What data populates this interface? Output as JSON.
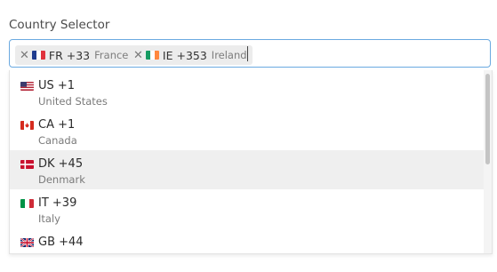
{
  "selector": {
    "label": "Country Selector",
    "selected": [
      {
        "flag": "fr",
        "code": "FR +33",
        "name": "France"
      },
      {
        "flag": "ie",
        "code": "IE +353",
        "name": "Ireland"
      }
    ],
    "remove_glyph": "✕"
  },
  "dropdown": {
    "options": [
      {
        "flag": "us",
        "code": "US +1",
        "name": "United States",
        "highlighted": false
      },
      {
        "flag": "ca",
        "code": "CA +1",
        "name": "Canada",
        "highlighted": false
      },
      {
        "flag": "dk",
        "code": "DK +45",
        "name": "Denmark",
        "highlighted": true
      },
      {
        "flag": "it",
        "code": "IT +39",
        "name": "Italy",
        "highlighted": false
      },
      {
        "flag": "gb",
        "code": "GB +44",
        "name": "",
        "highlighted": false
      }
    ]
  },
  "colors": {
    "focus_border": "#6aa9e0",
    "tag_bg": "#ececec",
    "highlight_bg": "#efefef"
  }
}
